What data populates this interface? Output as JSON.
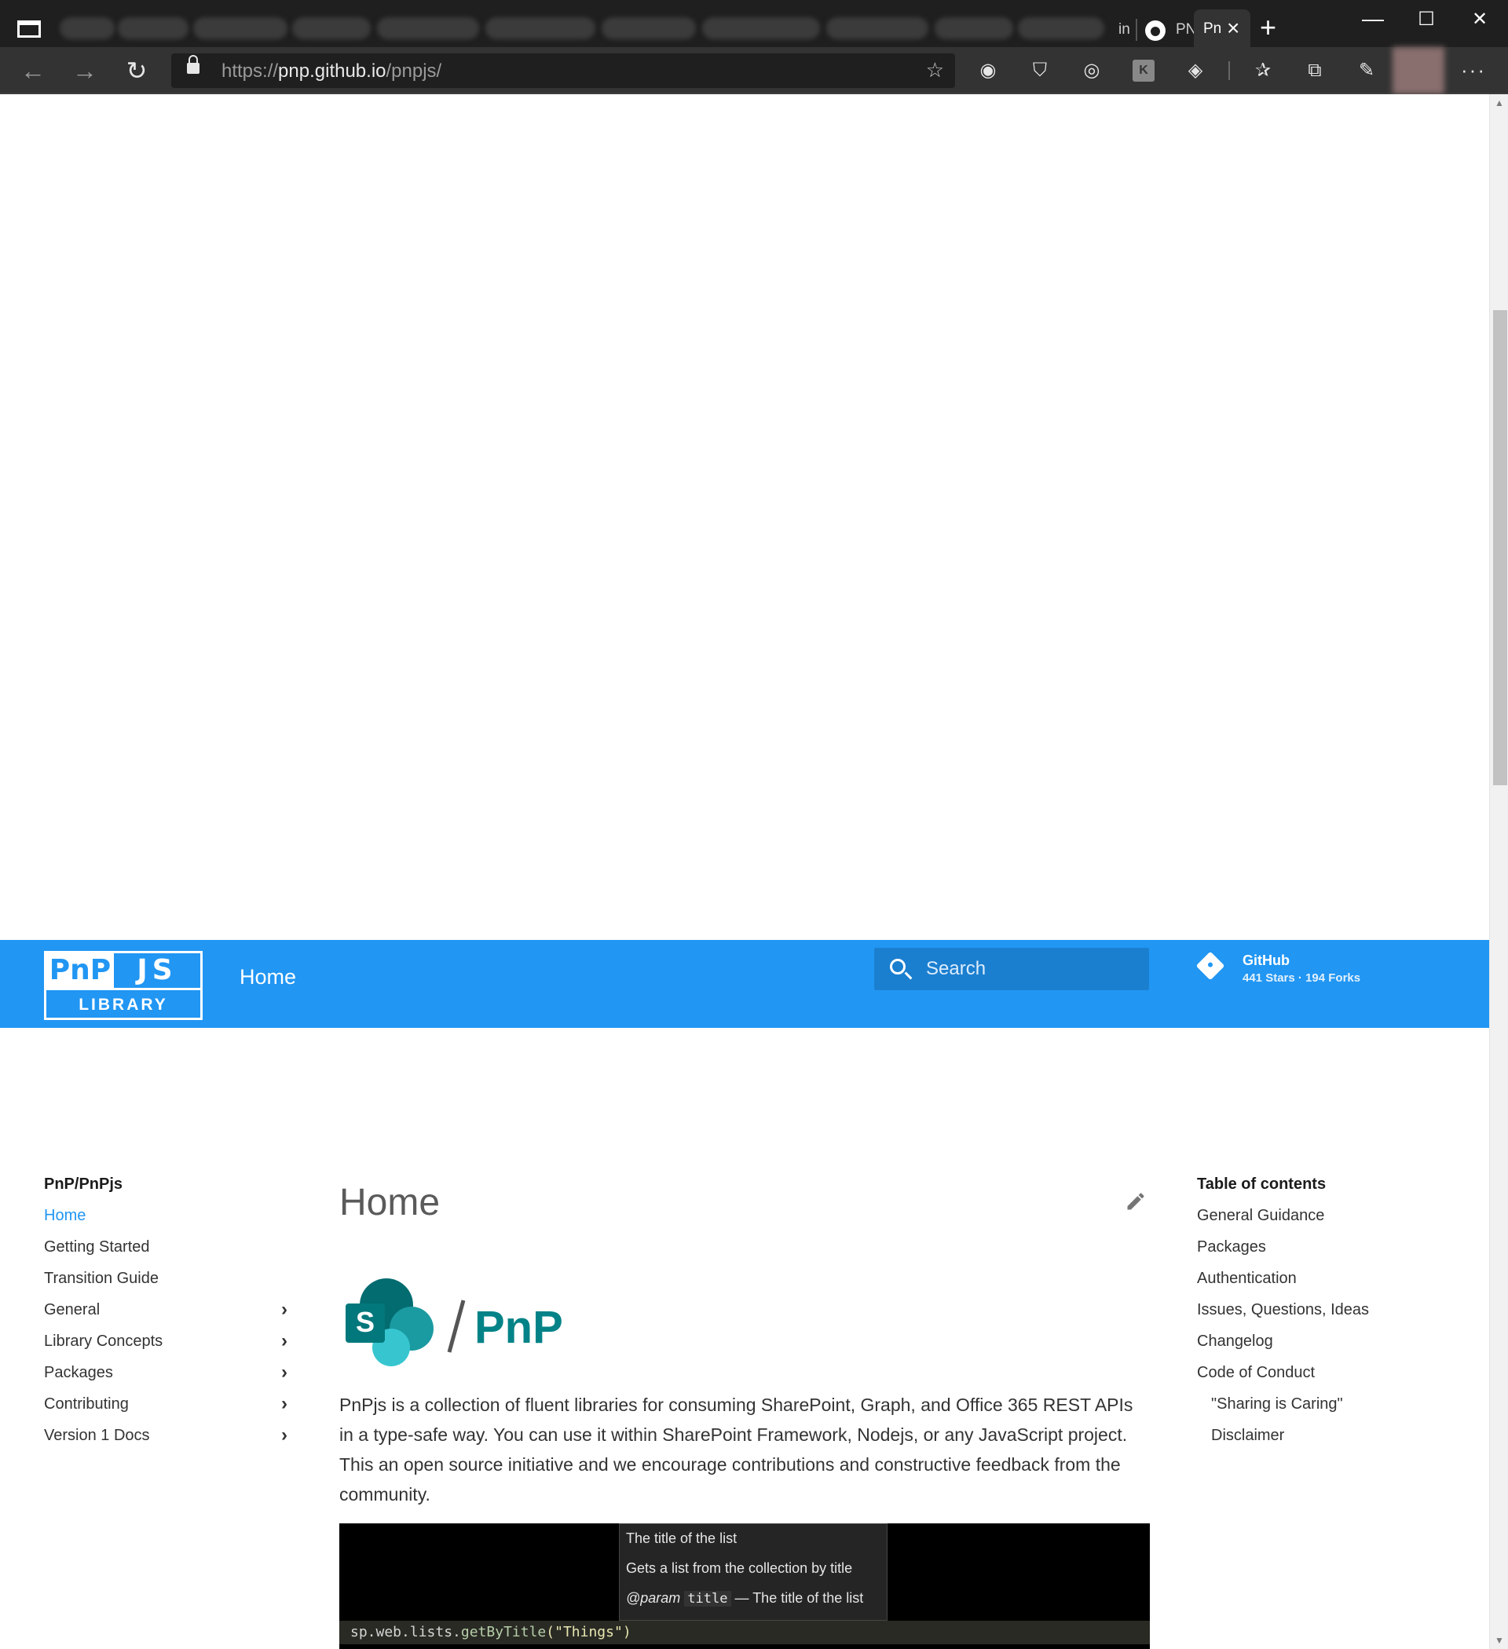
{
  "browser": {
    "tabs": {
      "partial_tab_1": "in",
      "partial_tab_2": "PN",
      "active_tab": "Pn"
    },
    "url": {
      "scheme": "https://",
      "host": "pnp.github.io",
      "path": "/pnpjs/"
    },
    "window_controls": {
      "minimize": "—",
      "maximize": "☐",
      "close": "✕"
    },
    "more_label": "···"
  },
  "header": {
    "logo": {
      "top_left": "PnP",
      "top_right": "JS",
      "bottom": "LIBRARY"
    },
    "title": "Home",
    "search_placeholder": "Search",
    "repo": {
      "name": "GitHub",
      "stats": "441 Stars · 194 Forks"
    },
    "accent_color": "#2196f3"
  },
  "left_nav": {
    "heading": "PnP/PnPjs",
    "items": [
      {
        "label": "Home",
        "active": true,
        "expandable": false
      },
      {
        "label": "Getting Started",
        "expandable": false
      },
      {
        "label": "Transition Guide",
        "expandable": false
      },
      {
        "label": "General",
        "expandable": true
      },
      {
        "label": "Library Concepts",
        "expandable": true
      },
      {
        "label": "Packages",
        "expandable": true
      },
      {
        "label": "Contributing",
        "expandable": true
      },
      {
        "label": "Version 1 Docs",
        "expandable": true
      }
    ],
    "chevron": "›"
  },
  "main": {
    "title": "Home",
    "logo_text": "PnP",
    "logo_letter": "S",
    "intro": "PnPjs is a collection of fluent libraries for consuming SharePoint, Graph, and Office 365 REST APIs in a type-safe way. You can use it within SharePoint Framework, Nodejs, or any JavaScript project. This an open source initiative and we encourage contributions and constructive feedback from the community.",
    "code_screenshot": {
      "tooltip_line1": "The title of the list",
      "tooltip_line2": "Gets a list from the collection by title",
      "tooltip_param_tag": "@param",
      "tooltip_param_name": "title",
      "tooltip_param_desc": "— The title of the list",
      "code_prefix": "sp.web.lists.",
      "code_fn": "getByTitle",
      "code_open": "(",
      "code_arg": "\"Things\"",
      "code_close": ")"
    }
  },
  "toc": {
    "heading": "Table of contents",
    "items": [
      {
        "label": "General Guidance"
      },
      {
        "label": "Packages"
      },
      {
        "label": "Authentication"
      },
      {
        "label": "Issues, Questions, Ideas"
      },
      {
        "label": "Changelog"
      },
      {
        "label": "Code of Conduct"
      },
      {
        "label": "\"Sharing is Caring\"",
        "sub": true
      },
      {
        "label": "Disclaimer",
        "sub": true
      }
    ]
  }
}
